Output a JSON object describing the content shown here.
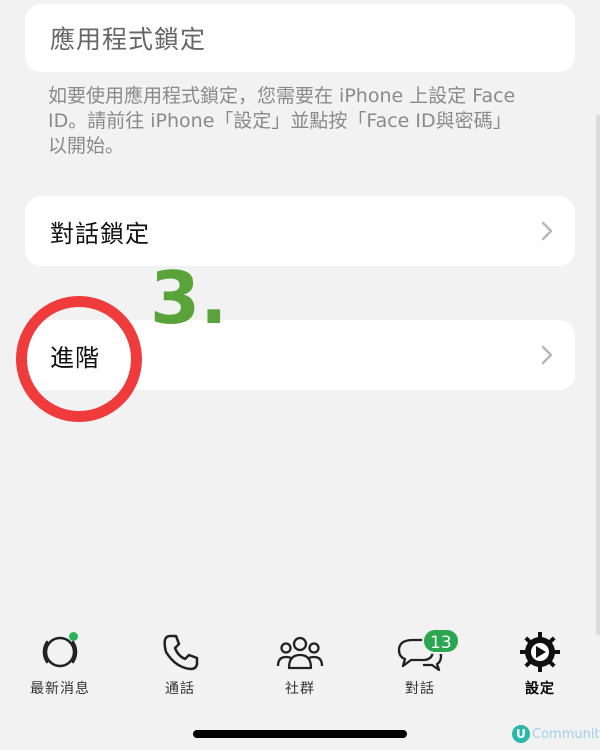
{
  "app_lock": {
    "title": "應用程式鎖定"
  },
  "description": {
    "line1": "如要使用應用程式鎖定，您需要在 iPhone 上設定 Face",
    "line2": "ID。請前往 iPhone「設定」並點按「Face ID與密碼」",
    "line3": "以開始。"
  },
  "menu": {
    "chat_lock": "對話鎖定",
    "advanced": "進階"
  },
  "annotation": {
    "step": "3."
  },
  "tabbar": {
    "tabs": [
      {
        "label": "最新消息"
      },
      {
        "label": "通話"
      },
      {
        "label": "社群"
      },
      {
        "label": "對話",
        "badge": "13"
      },
      {
        "label": "設定",
        "active": true
      }
    ]
  },
  "watermark": {
    "logo": "U",
    "text": "Community"
  },
  "colors": {
    "accent_green": "#2ba650",
    "highlight_red": "#ef3b3b",
    "step_green": "#5aa33a"
  }
}
